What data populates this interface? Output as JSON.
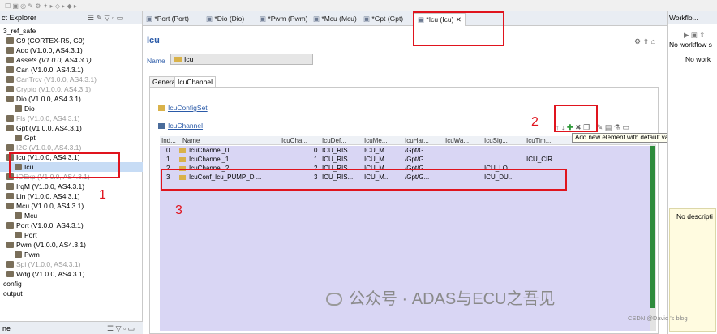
{
  "toolbar": {
    "icons": "☐ ▣ ◎ ✎ ⚙ ✦ ▸ ◇ ▸ ◆ ▸"
  },
  "explorer": {
    "title": "ct Explorer",
    "bottom_title": "ne",
    "items": [
      {
        "label": "3_ref_safe",
        "style": "plain",
        "indent": 4
      },
      {
        "label": "G9 (CORTEX-R5, G9)",
        "style": "plain",
        "indent": 8
      },
      {
        "label": "Adc (V1.0.0, AS4.3.1)",
        "style": "plain",
        "indent": 8
      },
      {
        "label": "Assets (V1.0.0, AS4.3.1)",
        "style": "italic",
        "indent": 8
      },
      {
        "label": "Can (V1.0.0, AS4.3.1)",
        "style": "plain",
        "indent": 8
      },
      {
        "label": "CanTrcv (V1.0.0, AS4.3.1)",
        "style": "gray",
        "indent": 8
      },
      {
        "label": "Crypto (V1.0.0, AS4.3.1)",
        "style": "gray",
        "indent": 8
      },
      {
        "label": "Dio (V1.0.0, AS4.3.1)",
        "style": "plain",
        "indent": 8
      },
      {
        "label": "Dio",
        "style": "plain",
        "indent": 18
      },
      {
        "label": "Fls (V1.0.0, AS4.3.1)",
        "style": "gray",
        "indent": 8
      },
      {
        "label": "Gpt (V1.0.0, AS4.3.1)",
        "style": "plain",
        "indent": 8
      },
      {
        "label": "Gpt",
        "style": "plain",
        "indent": 18
      },
      {
        "label": "I2C (V1.0.0, AS4.3.1)",
        "style": "gray",
        "indent": 8
      },
      {
        "label": "Icu (V1.0.0, AS4.3.1)",
        "style": "plain",
        "indent": 8
      },
      {
        "label": "Icu",
        "style": "selected",
        "indent": 18
      },
      {
        "label": "IOExp (V1.0.0, AS4.3.1)",
        "style": "gray",
        "indent": 8
      },
      {
        "label": "IrqM (V1.0.0, AS4.3.1)",
        "style": "plain",
        "indent": 8
      },
      {
        "label": "Lin (V1.0.0, AS4.3.1)",
        "style": "plain",
        "indent": 8
      },
      {
        "label": "Mcu (V1.0.0, AS4.3.1)",
        "style": "plain",
        "indent": 8
      },
      {
        "label": "Mcu",
        "style": "plain",
        "indent": 18
      },
      {
        "label": "Port (V1.0.0, AS4.3.1)",
        "style": "plain",
        "indent": 8
      },
      {
        "label": "Port",
        "style": "plain",
        "indent": 18
      },
      {
        "label": "Pwm (V1.0.0, AS4.3.1)",
        "style": "plain",
        "indent": 8
      },
      {
        "label": "Pwm",
        "style": "plain",
        "indent": 18
      },
      {
        "label": "Spi (V1.0.0, AS4.3.1)",
        "style": "gray",
        "indent": 8
      },
      {
        "label": "Wdg (V1.0.0, AS4.3.1)",
        "style": "plain",
        "indent": 8
      },
      {
        "label": "config",
        "style": "plain",
        "indent": 4
      },
      {
        "label": "output",
        "style": "plain",
        "indent": 4
      }
    ]
  },
  "tabs": [
    {
      "label": "*Port (Port)"
    },
    {
      "label": "*Dio (Dio)"
    },
    {
      "label": "*Pwm (Pwm)"
    },
    {
      "label": "*Mcu (Mcu)"
    },
    {
      "label": "*Gpt (Gpt)"
    },
    {
      "label": "*Icu (Icu)",
      "active": true
    }
  ],
  "editor": {
    "title": "Icu",
    "name_label": "Name",
    "name_value": "Icu",
    "subtabs": [
      "General",
      "IcuChannel"
    ],
    "config_link": "IcuConfigSet",
    "section_link": "IcuChannel",
    "tooltip": "Add new element with default values",
    "columns": [
      "Ind...",
      "Name",
      "IcuCha...",
      "IcuDef...",
      "IcuMe...",
      "IcuHar...",
      "IcuWa...",
      "IcuSig...",
      "IcuTim..."
    ],
    "rows": [
      {
        "index": "0",
        "name": "IcuChannel_0",
        "cha": "0",
        "def": "ICU_RIS...",
        "me": "ICU_M...",
        "har": "/Gpt/G...",
        "wa": "",
        "sig": "",
        "tim": ""
      },
      {
        "index": "1",
        "name": "IcuChannel_1",
        "cha": "1",
        "def": "ICU_RIS...",
        "me": "ICU_M...",
        "har": "/Gpt/G...",
        "wa": "",
        "sig": "",
        "tim": "ICU_CIR..."
      },
      {
        "index": "2",
        "name": "IcuChannel_2",
        "cha": "2",
        "def": "ICU_RIS...",
        "me": "ICU_M...",
        "har": "/Gpt/G...",
        "wa": "",
        "sig": "ICU_LO...",
        "tim": ""
      },
      {
        "index": "3",
        "name": "IcuConf_Icu_PUMP_DI...",
        "cha": "3",
        "def": "ICU_RIS...",
        "me": "ICU_M...",
        "har": "/Gpt/G...",
        "wa": "",
        "sig": "ICU_DU...",
        "tim": ""
      }
    ]
  },
  "workflow": {
    "title": "Workflo...",
    "line1": "No workflow s",
    "line2": "No work",
    "line3": "No descripti"
  },
  "annotations": {
    "n1": "1",
    "n2": "2",
    "n3": "3"
  },
  "watermark": "公众号 · ADAS与ECU之吾见",
  "csdn": "CSDN @David 's blog"
}
